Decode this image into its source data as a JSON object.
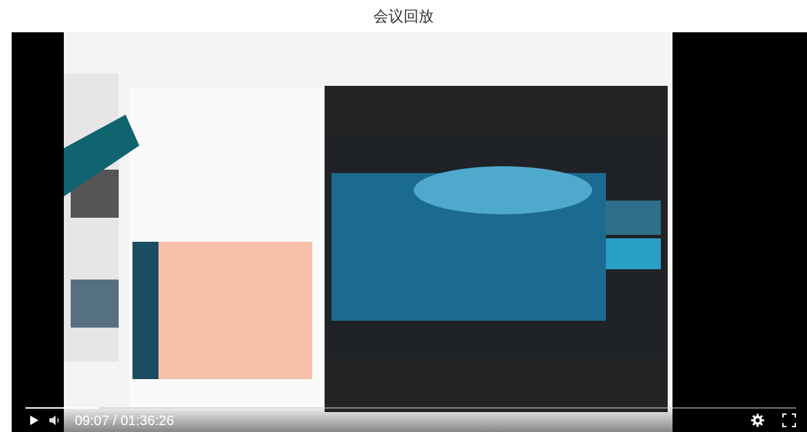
{
  "title": "会议回放",
  "player": {
    "progress": {
      "level": 0.095
    },
    "time": "09:07 / 01:36:26"
  }
}
